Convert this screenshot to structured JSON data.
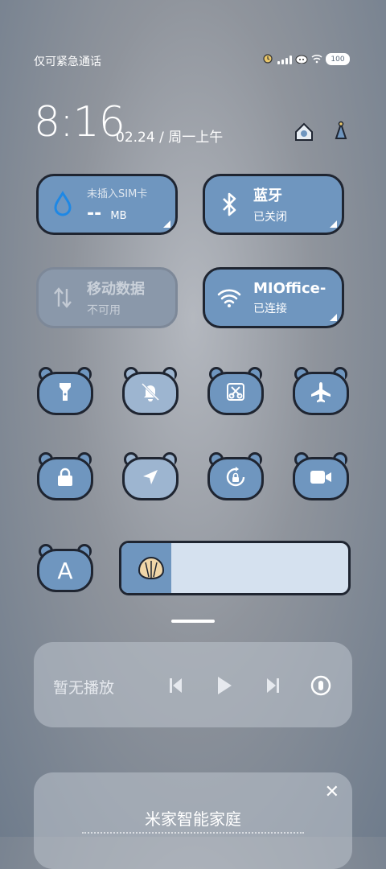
{
  "status": {
    "carrier": "仅可紧急通话",
    "battery": "100"
  },
  "time": {
    "clock": "8:16",
    "date": "02.24 / 周一上午"
  },
  "tiles": {
    "sim": {
      "label": "未插入SIM卡",
      "value": "--",
      "unit": "MB"
    },
    "bluetooth": {
      "label": "蓝牙",
      "status": "已关闭"
    },
    "mobile_data": {
      "label": "移动数据",
      "status": "不可用"
    },
    "wifi": {
      "label": "MIOffice-",
      "status": "已连接"
    }
  },
  "toggles": [
    {
      "name": "flashlight",
      "state": "on"
    },
    {
      "name": "mute",
      "state": "off"
    },
    {
      "name": "screenshot",
      "state": "on"
    },
    {
      "name": "airplane-mode",
      "state": "on"
    },
    {
      "name": "lock-screen",
      "state": "on"
    },
    {
      "name": "location",
      "state": "off"
    },
    {
      "name": "auto-rotate",
      "state": "on"
    },
    {
      "name": "screen-record",
      "state": "on"
    }
  ],
  "auto_brightness": {
    "label": "A"
  },
  "brightness": {
    "level": 0.22
  },
  "media": {
    "label": "暂无播放"
  },
  "home_card": {
    "title": "米家智能家庭"
  },
  "colors": {
    "accent": "#6f96bf",
    "outline": "#1f2531",
    "track": "#d5e1ef"
  }
}
